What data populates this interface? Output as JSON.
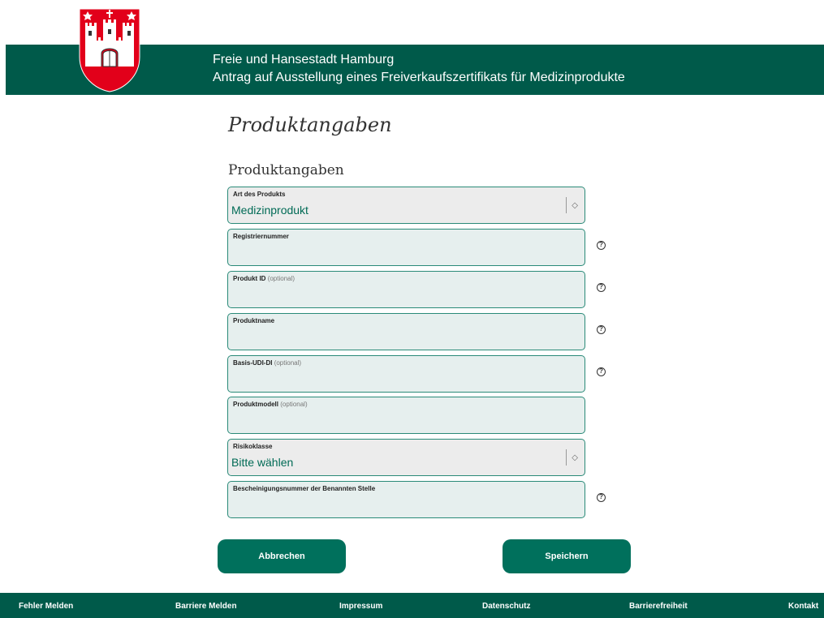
{
  "header": {
    "organization": "Freie und Hansestadt Hamburg",
    "title": "Antrag auf Ausstellung eines Freiverkaufszertifikats für Medizinprodukte"
  },
  "page_title": "Produktangaben",
  "section_title": "Produktangaben",
  "fields": [
    {
      "label": "Art des Produkts",
      "optional": "",
      "value": "Medizinprodukt",
      "type": "select"
    },
    {
      "label": "Registriernummer",
      "optional": "",
      "value": "",
      "type": "text"
    },
    {
      "label": "Produkt ID",
      "optional": "(optional)",
      "value": "",
      "type": "text"
    },
    {
      "label": "Produktname",
      "optional": "",
      "value": "",
      "type": "text"
    },
    {
      "label": "Basis-UDI-DI",
      "optional": "(optional)",
      "value": "",
      "type": "text"
    },
    {
      "label": "Produktmodell",
      "optional": "(optional)",
      "value": "",
      "type": "text"
    },
    {
      "label": "Risikoklasse",
      "optional": "",
      "value": "Bitte wählen",
      "type": "select"
    },
    {
      "label": "Bescheinigungsnummer der Benannten Stelle",
      "optional": "",
      "value": "",
      "type": "text"
    }
  ],
  "help_icon_glyph": "?",
  "buttons": {
    "cancel": "Abbrechen",
    "save": "Speichern"
  },
  "footer": {
    "links": [
      "Fehler Melden",
      "Barriere Melden",
      "Impressum",
      "Datenschutz",
      "Barrierefreiheit",
      "Kontakt"
    ]
  },
  "colors": {
    "brand_green": "#005a4a",
    "button_green": "#00705c",
    "field_border": "#2a8a78",
    "field_bg": "#e6efee",
    "crest_red": "#e2001a"
  }
}
